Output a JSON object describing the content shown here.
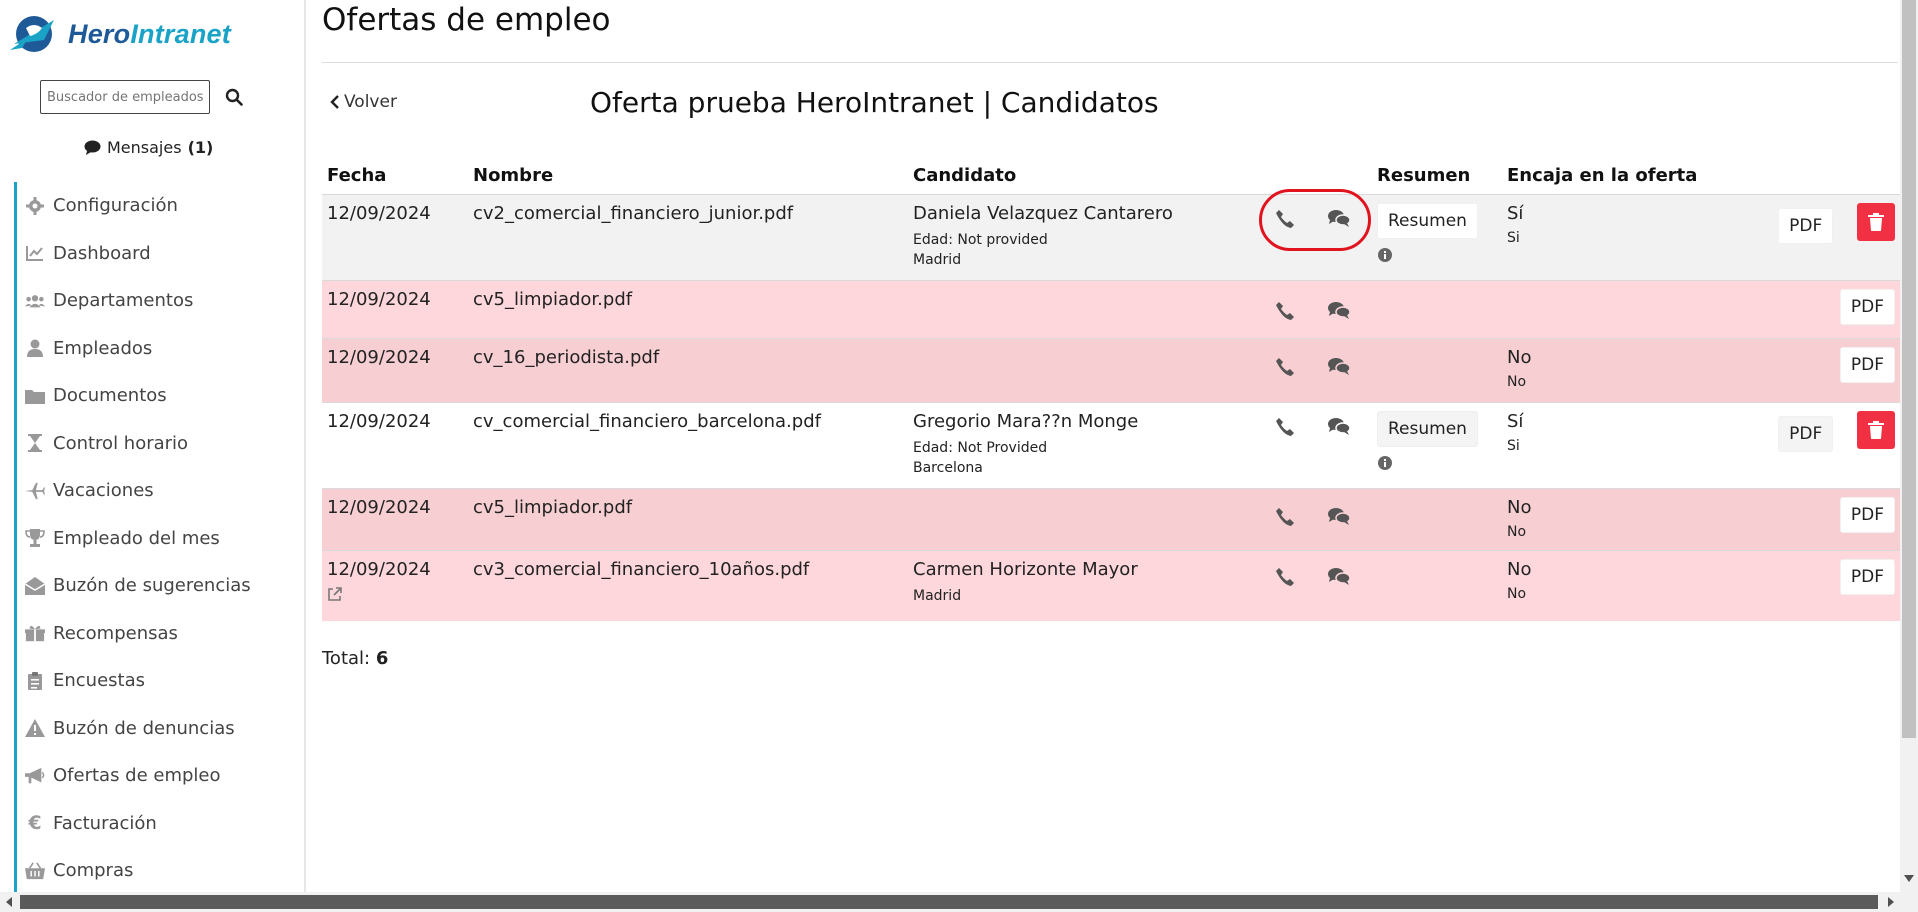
{
  "brand": {
    "part1": "Hero",
    "part2": "Intranet"
  },
  "search": {
    "placeholder": "Buscador de empleados..."
  },
  "messages": {
    "label": "Mensajes",
    "count": "(1)"
  },
  "nav": [
    {
      "label": "Configuración",
      "icon": "gear-icon"
    },
    {
      "label": "Dashboard",
      "icon": "chart-line-icon"
    },
    {
      "label": "Departamentos",
      "icon": "users-icon"
    },
    {
      "label": "Empleados",
      "icon": "user-icon"
    },
    {
      "label": "Documentos",
      "icon": "folder-icon"
    },
    {
      "label": "Control horario",
      "icon": "hourglass-icon"
    },
    {
      "label": "Vacaciones",
      "icon": "plane-icon"
    },
    {
      "label": "Empleado del mes",
      "icon": "trophy-icon"
    },
    {
      "label": "Buzón de sugerencias",
      "icon": "envelope-open-icon"
    },
    {
      "label": "Recompensas",
      "icon": "gift-icon"
    },
    {
      "label": "Encuestas",
      "icon": "clipboard-icon"
    },
    {
      "label": "Buzón de denuncias",
      "icon": "warning-icon"
    },
    {
      "label": "Ofertas de empleo",
      "icon": "megaphone-icon"
    },
    {
      "label": "Facturación",
      "icon": "euro-icon"
    },
    {
      "label": "Compras",
      "icon": "basket-icon"
    }
  ],
  "page": {
    "title": "Ofertas de empleo",
    "back": "Volver",
    "subtitle": "Oferta prueba HeroIntranet | Candidatos"
  },
  "table": {
    "headers": {
      "fecha": "Fecha",
      "nombre": "Nombre",
      "candidato": "Candidato",
      "resumen": "Resumen",
      "encaja": "Encaja en la oferta"
    },
    "rows": [
      {
        "fecha": "12/09/2024",
        "nombre": "cv2_comercial_financiero_junior.pdf",
        "candidato": "Daniela Velazquez Cantarero",
        "edad": "Edad: Not provided",
        "ciudad": "Madrid",
        "resumen_btn": "Resumen",
        "encaja": "Sí",
        "encaja_sub": "Si",
        "pdf": "PDF"
      },
      {
        "fecha": "12/09/2024",
        "nombre": "cv5_limpiador.pdf",
        "candidato": "",
        "edad": "",
        "ciudad": "",
        "resumen_btn": "",
        "encaja": "",
        "encaja_sub": "",
        "pdf": "PDF"
      },
      {
        "fecha": "12/09/2024",
        "nombre": "cv_16_periodista.pdf",
        "candidato": "",
        "edad": "",
        "ciudad": "",
        "resumen_btn": "",
        "encaja": "No",
        "encaja_sub": "No",
        "pdf": "PDF"
      },
      {
        "fecha": "12/09/2024",
        "nombre": "cv_comercial_financiero_barcelona.pdf",
        "candidato": "Gregorio Mara??n Monge",
        "edad": "Edad: Not Provided",
        "ciudad": "Barcelona",
        "resumen_btn": "Resumen",
        "encaja": "Sí",
        "encaja_sub": "Si",
        "pdf": "PDF"
      },
      {
        "fecha": "12/09/2024",
        "nombre": "cv5_limpiador.pdf",
        "candidato": "",
        "edad": "",
        "ciudad": "",
        "resumen_btn": "",
        "encaja": "No",
        "encaja_sub": "No",
        "pdf": "PDF"
      },
      {
        "fecha": "12/09/2024",
        "nombre": "cv3_comercial_financiero_10años.pdf",
        "candidato": "Carmen Horizonte Mayor",
        "edad": "",
        "ciudad": "Madrid",
        "resumen_btn": "",
        "encaja": "No",
        "encaja_sub": "No",
        "pdf": "PDF"
      }
    ]
  },
  "total": {
    "label": "Total:",
    "value": "6"
  },
  "colors": {
    "accent": "#1aa3c7",
    "brand_dark": "#1f5a98",
    "danger": "#f23043",
    "row_gray": "#f2f2f2",
    "row_pink": "#fdd7dc",
    "highlight": "#e0141f"
  }
}
